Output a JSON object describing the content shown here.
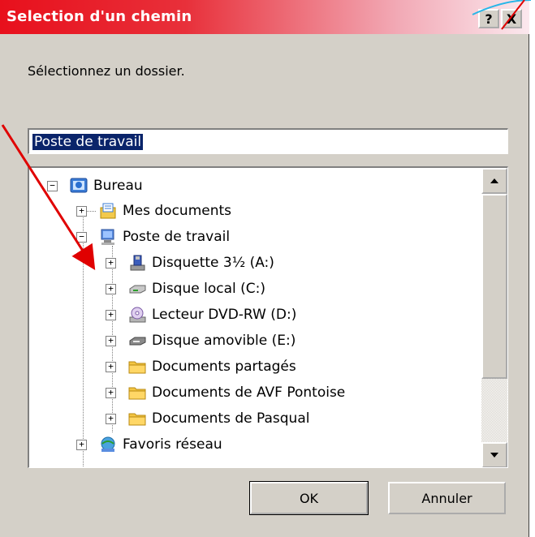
{
  "window": {
    "title": "Selection d'un chemin",
    "help_label": "?",
    "close_label": "X"
  },
  "prompt": "Sélectionnez un dossier.",
  "path_field": {
    "value": "Poste de travail"
  },
  "tree": {
    "items": [
      {
        "label": "Bureau",
        "icon": "desktop-icon",
        "expander": "−"
      },
      {
        "label": "Mes documents",
        "icon": "documents-icon",
        "expander": "+"
      },
      {
        "label": "Poste de travail",
        "icon": "computer-icon",
        "expander": "−"
      },
      {
        "label": "Disquette 3½ (A:)",
        "icon": "floppy-icon",
        "expander": "+"
      },
      {
        "label": "Disque local (C:)",
        "icon": "harddisk-icon",
        "expander": "+"
      },
      {
        "label": "Lecteur DVD-RW (D:)",
        "icon": "dvd-icon",
        "expander": "+"
      },
      {
        "label": "Disque amovible (E:)",
        "icon": "removable-disk-icon",
        "expander": "+"
      },
      {
        "label": "Documents partagés",
        "icon": "folder-icon",
        "expander": "+"
      },
      {
        "label": "Documents de AVF Pontoise",
        "icon": "folder-icon",
        "expander": "+"
      },
      {
        "label": "Documents de Pasqual",
        "icon": "folder-icon",
        "expander": "+"
      },
      {
        "label": "Favoris réseau",
        "icon": "network-icon",
        "expander": "+"
      }
    ]
  },
  "buttons": {
    "ok": "OK",
    "cancel": "Annuler"
  },
  "colors": {
    "title_start": "#e8101c",
    "selection": "#0a246a",
    "annotation": "#e00000"
  }
}
